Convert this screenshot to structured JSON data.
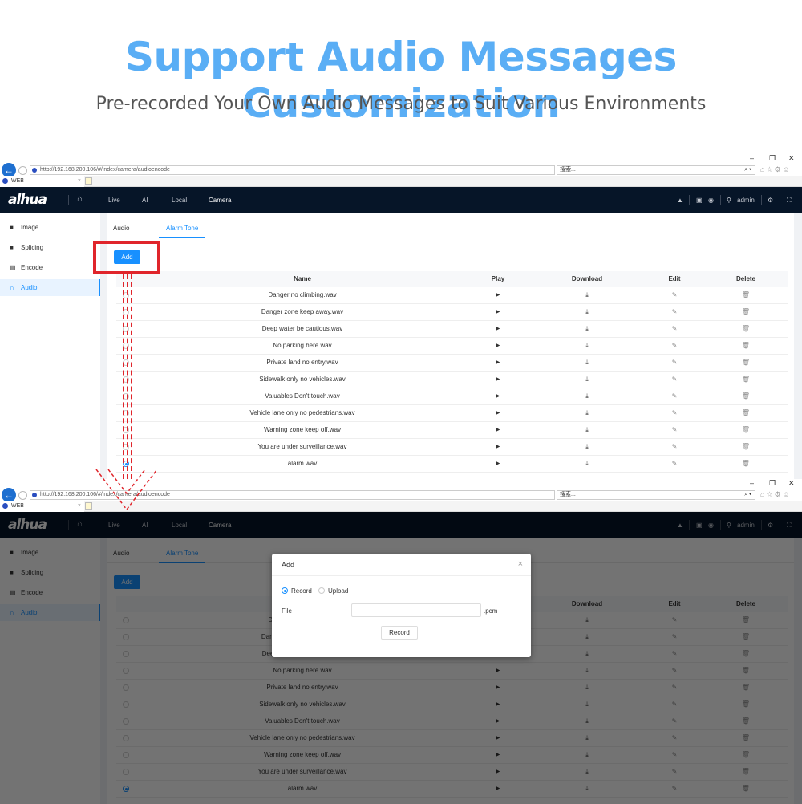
{
  "headline": "Support Audio Messages Customization",
  "subheadline": "Pre-recorded Your Own Audio Messages to Suit Various Environments",
  "colors": {
    "headline": "#5aaef5",
    "accent": "#1890ff",
    "nav_bg": "#061528",
    "highlight": "#e0252b"
  },
  "browser": {
    "url": "http://192.168.200.106/#/index/camera/audioencode",
    "search_placeholder": "搜索...",
    "tab_title": "WEB",
    "window_controls": [
      "–",
      "❐",
      "✕"
    ]
  },
  "nav": {
    "logo": "alhua",
    "items": [
      "Live",
      "AI",
      "Local",
      "Camera"
    ],
    "active": "Camera",
    "user": "admin"
  },
  "sidebar": {
    "items": [
      {
        "label": "Image",
        "icon": "camera-icon"
      },
      {
        "label": "Splicing",
        "icon": "camera-icon"
      },
      {
        "label": "Encode",
        "icon": "encode-icon"
      },
      {
        "label": "Audio",
        "icon": "headphones-icon",
        "active": true
      }
    ]
  },
  "tabs": [
    {
      "label": "Audio"
    },
    {
      "label": "Alarm Tone",
      "active": true
    }
  ],
  "add_label": "Add",
  "table": {
    "columns": [
      "Name",
      "Play",
      "Download",
      "Edit",
      "Delete"
    ],
    "rows": [
      "Danger no climbing.wav",
      "Danger zone keep away.wav",
      "Deep water be cautious.wav",
      "No parking here.wav",
      "Private land no entry.wav",
      "Sidewalk only no vehicles.wav",
      "Valuables Don't touch.wav",
      "Vehicle lane only no pedestrians.wav",
      "Warning zone keep off.wav",
      "You are under surveillance.wav",
      "alarm.wav"
    ],
    "selected": "alarm.wav"
  },
  "modal": {
    "title": "Add",
    "options": [
      "Record",
      "Upload"
    ],
    "selected_option": "Record",
    "file_label": "File",
    "file_value": "",
    "file_ext": ".pcm",
    "action_label": "Record"
  }
}
